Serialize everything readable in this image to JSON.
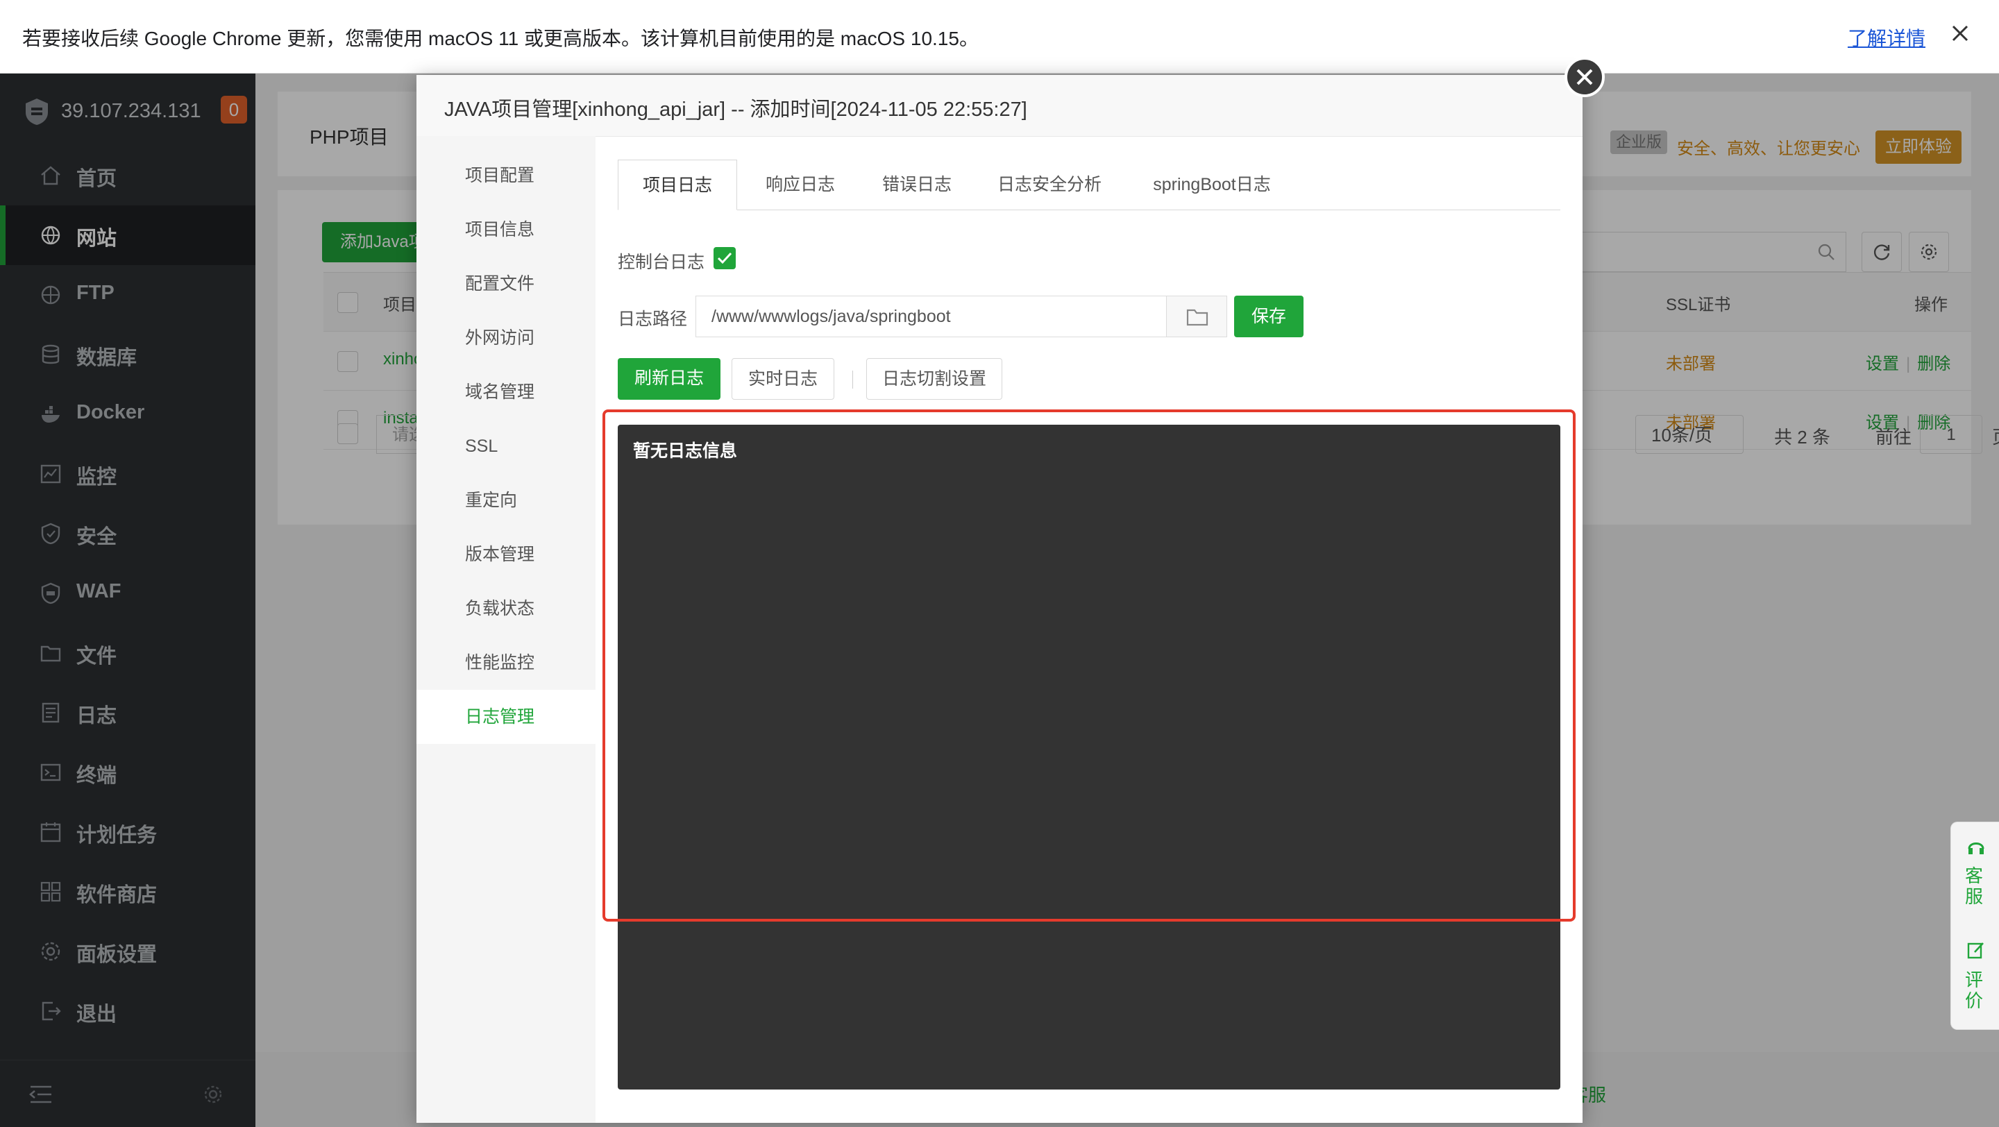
{
  "infobar": {
    "message": "若要接收后续 Google Chrome 更新，您需使用 macOS 11 或更高版本。该计算机目前使用的是 macOS 10.15。",
    "learn_more": "了解详情"
  },
  "sidebar": {
    "ip": "39.107.234.131",
    "badge": "0",
    "items": [
      {
        "label": "首页",
        "icon": "home-icon"
      },
      {
        "label": "网站",
        "icon": "globe-icon",
        "active": true
      },
      {
        "label": "FTP",
        "icon": "ftp-icon"
      },
      {
        "label": "数据库",
        "icon": "database-icon"
      },
      {
        "label": "Docker",
        "icon": "docker-icon"
      },
      {
        "label": "监控",
        "icon": "monitor-icon"
      },
      {
        "label": "安全",
        "icon": "shield-icon"
      },
      {
        "label": "WAF",
        "icon": "waf-icon"
      },
      {
        "label": "文件",
        "icon": "folder-icon"
      },
      {
        "label": "日志",
        "icon": "log-icon"
      },
      {
        "label": "终端",
        "icon": "terminal-icon"
      },
      {
        "label": "计划任务",
        "icon": "calendar-icon"
      },
      {
        "label": "软件商店",
        "icon": "apps-icon"
      },
      {
        "label": "面板设置",
        "icon": "gear-icon"
      },
      {
        "label": "退出",
        "icon": "logout-icon"
      }
    ]
  },
  "background": {
    "tab_title": "PHP项目",
    "enterprise_tag": "企业版",
    "slogan": "安全、高效、让您更安心",
    "try_button": "立即体验",
    "add_button": "添加Java项目",
    "table": {
      "head_name": "项目名称",
      "head_ssl": "SSL证书",
      "head_op": "操作",
      "rows": [
        {
          "name": "xinhong",
          "ssl": "未部署",
          "settings": "设置",
          "delete": "删除"
        },
        {
          "name": "instart_",
          "ssl": "未部署",
          "settings": "设置",
          "delete": "删除"
        }
      ]
    },
    "pager": {
      "select_placeholder": "请选择",
      "page_size": "10条/页",
      "total": "共 2 条",
      "goto": "前往",
      "page": "1",
      "page_unit": "页"
    },
    "footer_text": "客服"
  },
  "float_service": {
    "service": "客服",
    "review": "评价"
  },
  "modal": {
    "title": "JAVA项目管理[xinhong_api_jar] -- 添加时间[2024-11-05 22:55:27]",
    "side_items": [
      {
        "label": "项目配置"
      },
      {
        "label": "项目信息"
      },
      {
        "label": "配置文件"
      },
      {
        "label": "外网访问"
      },
      {
        "label": "域名管理"
      },
      {
        "label": "SSL"
      },
      {
        "label": "重定向"
      },
      {
        "label": "版本管理"
      },
      {
        "label": "负载状态"
      },
      {
        "label": "性能监控"
      },
      {
        "label": "日志管理",
        "active": true
      }
    ],
    "tabs": [
      "项目日志",
      "响应日志",
      "错误日志",
      "日志安全分析",
      "springBoot日志"
    ],
    "console_log_label": "控制台日志",
    "console_log_checked": true,
    "log_path_label": "日志路径",
    "log_path_value": "/www/wwwlogs/java/springboot",
    "save": "保存",
    "refresh": "刷新日志",
    "realtime": "实时日志",
    "rotate": "日志切割设置",
    "empty_log": "暂无日志信息"
  },
  "colors": {
    "accent": "#20a53a",
    "sidebar_bg": "#2c2f33",
    "highlight_frame": "#e53b2c",
    "console_bg": "#333333"
  }
}
